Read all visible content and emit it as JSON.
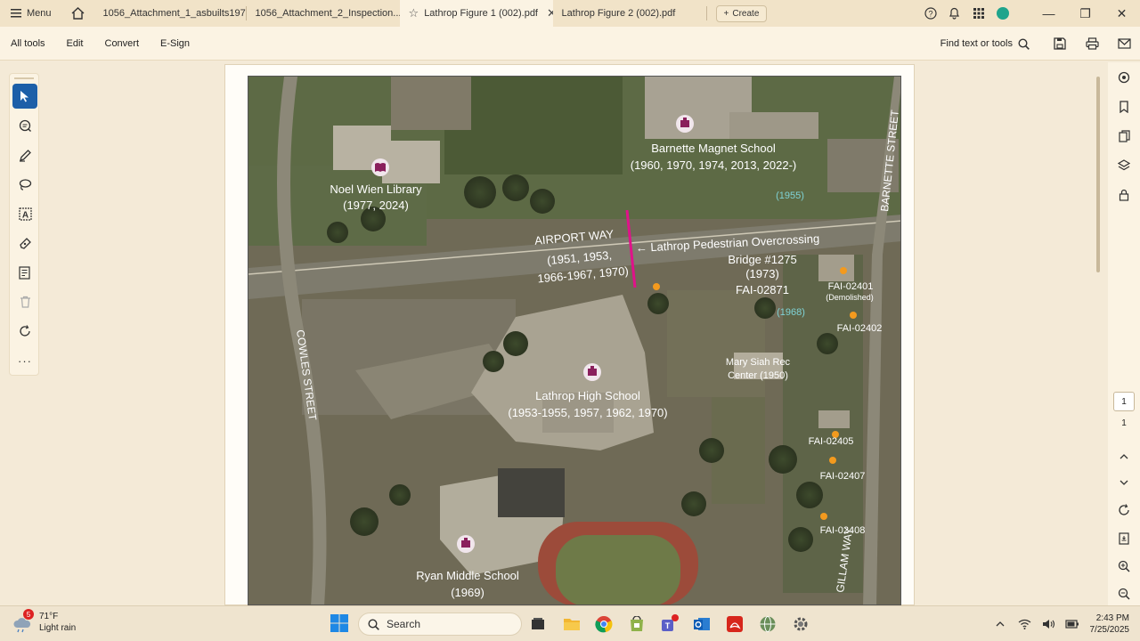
{
  "titlebar": {
    "menu_label": "Menu",
    "tabs": [
      {
        "label": "1056_Attachment_1_asbuilts197..."
      },
      {
        "label": "1056_Attachment_2_Inspection..."
      },
      {
        "label": "Lathrop Figure 1 (002).pdf",
        "active": true
      },
      {
        "label": "Lathrop Figure 2 (002).pdf"
      }
    ],
    "create_label": "Create"
  },
  "toolbar": {
    "items": [
      "All tools",
      "Edit",
      "Convert",
      "E-Sign"
    ],
    "find_label": "Find text or tools"
  },
  "map": {
    "labels": {
      "barnette_school": "Barnette Magnet School",
      "barnette_years": "(1960, 1970, 1974, 2013, 2022-)",
      "barnette_code": "(1955)",
      "library": "Noel Wien Library",
      "library_years": "(1977, 2024)",
      "airport_way": "AIRPORT WAY",
      "airport_years_1": "(1951, 1953,",
      "airport_years_2": "1966-1967, 1970)",
      "overcrossing_1": "← Lathrop Pedestrian Overcrossing",
      "overcrossing_2": "Bridge #1275",
      "overcrossing_3": "(1973)",
      "overcrossing_4": "FAI-02871",
      "fai_02401": "FAI-02401",
      "demolished": "(Demolished)",
      "code_1968": "(1968)",
      "fai_02402": "FAI-02402",
      "mary_siah_1": "Mary Siah Rec",
      "mary_siah_2": "Center (1950)",
      "lathrop_hs": "Lathrop High School",
      "lathrop_hs_years": "(1953-1955, 1957, 1962, 1970)",
      "fai_02405": "FAI-02405",
      "fai_02407": "FAI-02407",
      "fai_02408": "FAI-02408",
      "ryan_ms": "Ryan Middle School",
      "ryan_ms_years": "(1969)",
      "cowles": "COWLES STREET",
      "barnette_st": "BARNETTE STREET",
      "gillam": "GILLAM WAY"
    }
  },
  "rightrail": {
    "page_current": "1",
    "page_total": "1"
  },
  "taskbar": {
    "weather_badge": "5",
    "temp": "71°F",
    "condition": "Light rain",
    "search_label": "Search",
    "time": "2:43 PM",
    "date": "7/25/2025"
  },
  "colors": {
    "accent": "#1c5fa8",
    "marker_orange": "#f39a1e",
    "overcrossing_magenta": "#e0128a",
    "map_label": "#ffffff"
  }
}
